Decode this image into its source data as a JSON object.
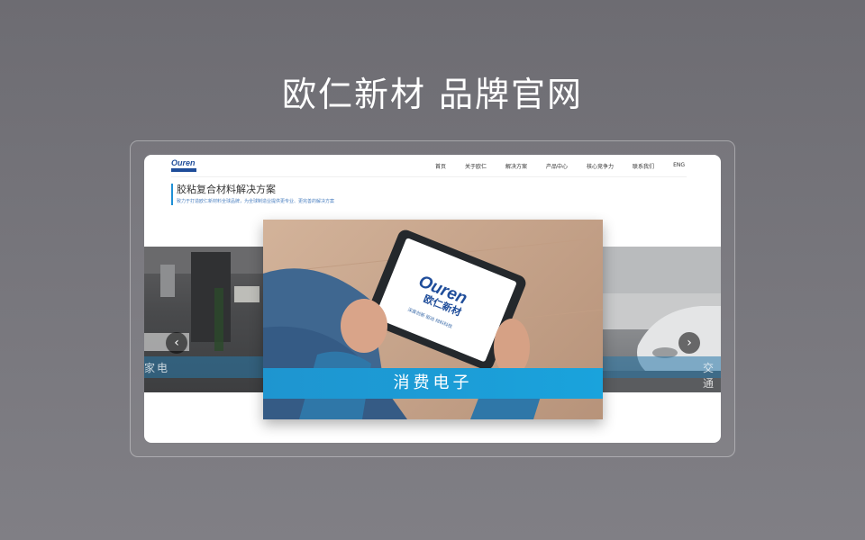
{
  "page_title": "欧仁新材  品牌官网",
  "site": {
    "logo_text": "Ouren",
    "nav": [
      "首页",
      "关于欧仁",
      "解决方案",
      "产品中心",
      "核心竞争力",
      "联系我们",
      "ENG"
    ],
    "headline": {
      "title": "胶粘复合材料解决方案",
      "subtitle": "致力于打造欧仁新材料全球品牌，为全球制造业提供更专业、更完善的解决方案"
    },
    "carousel": {
      "slides": [
        {
          "label": "家电"
        },
        {
          "label": "消费电子"
        },
        {
          "label": "交通"
        }
      ],
      "tablet_logo": "Ouren",
      "tablet_logo_cn": "欧仁新材",
      "tablet_slogan": "深度创新  驱动  材料科技",
      "prev_icon": "‹",
      "next_icon": "›"
    }
  },
  "colors": {
    "accent": "#1e95d0",
    "logo": "#1f4d9a",
    "background": "#76757b"
  }
}
